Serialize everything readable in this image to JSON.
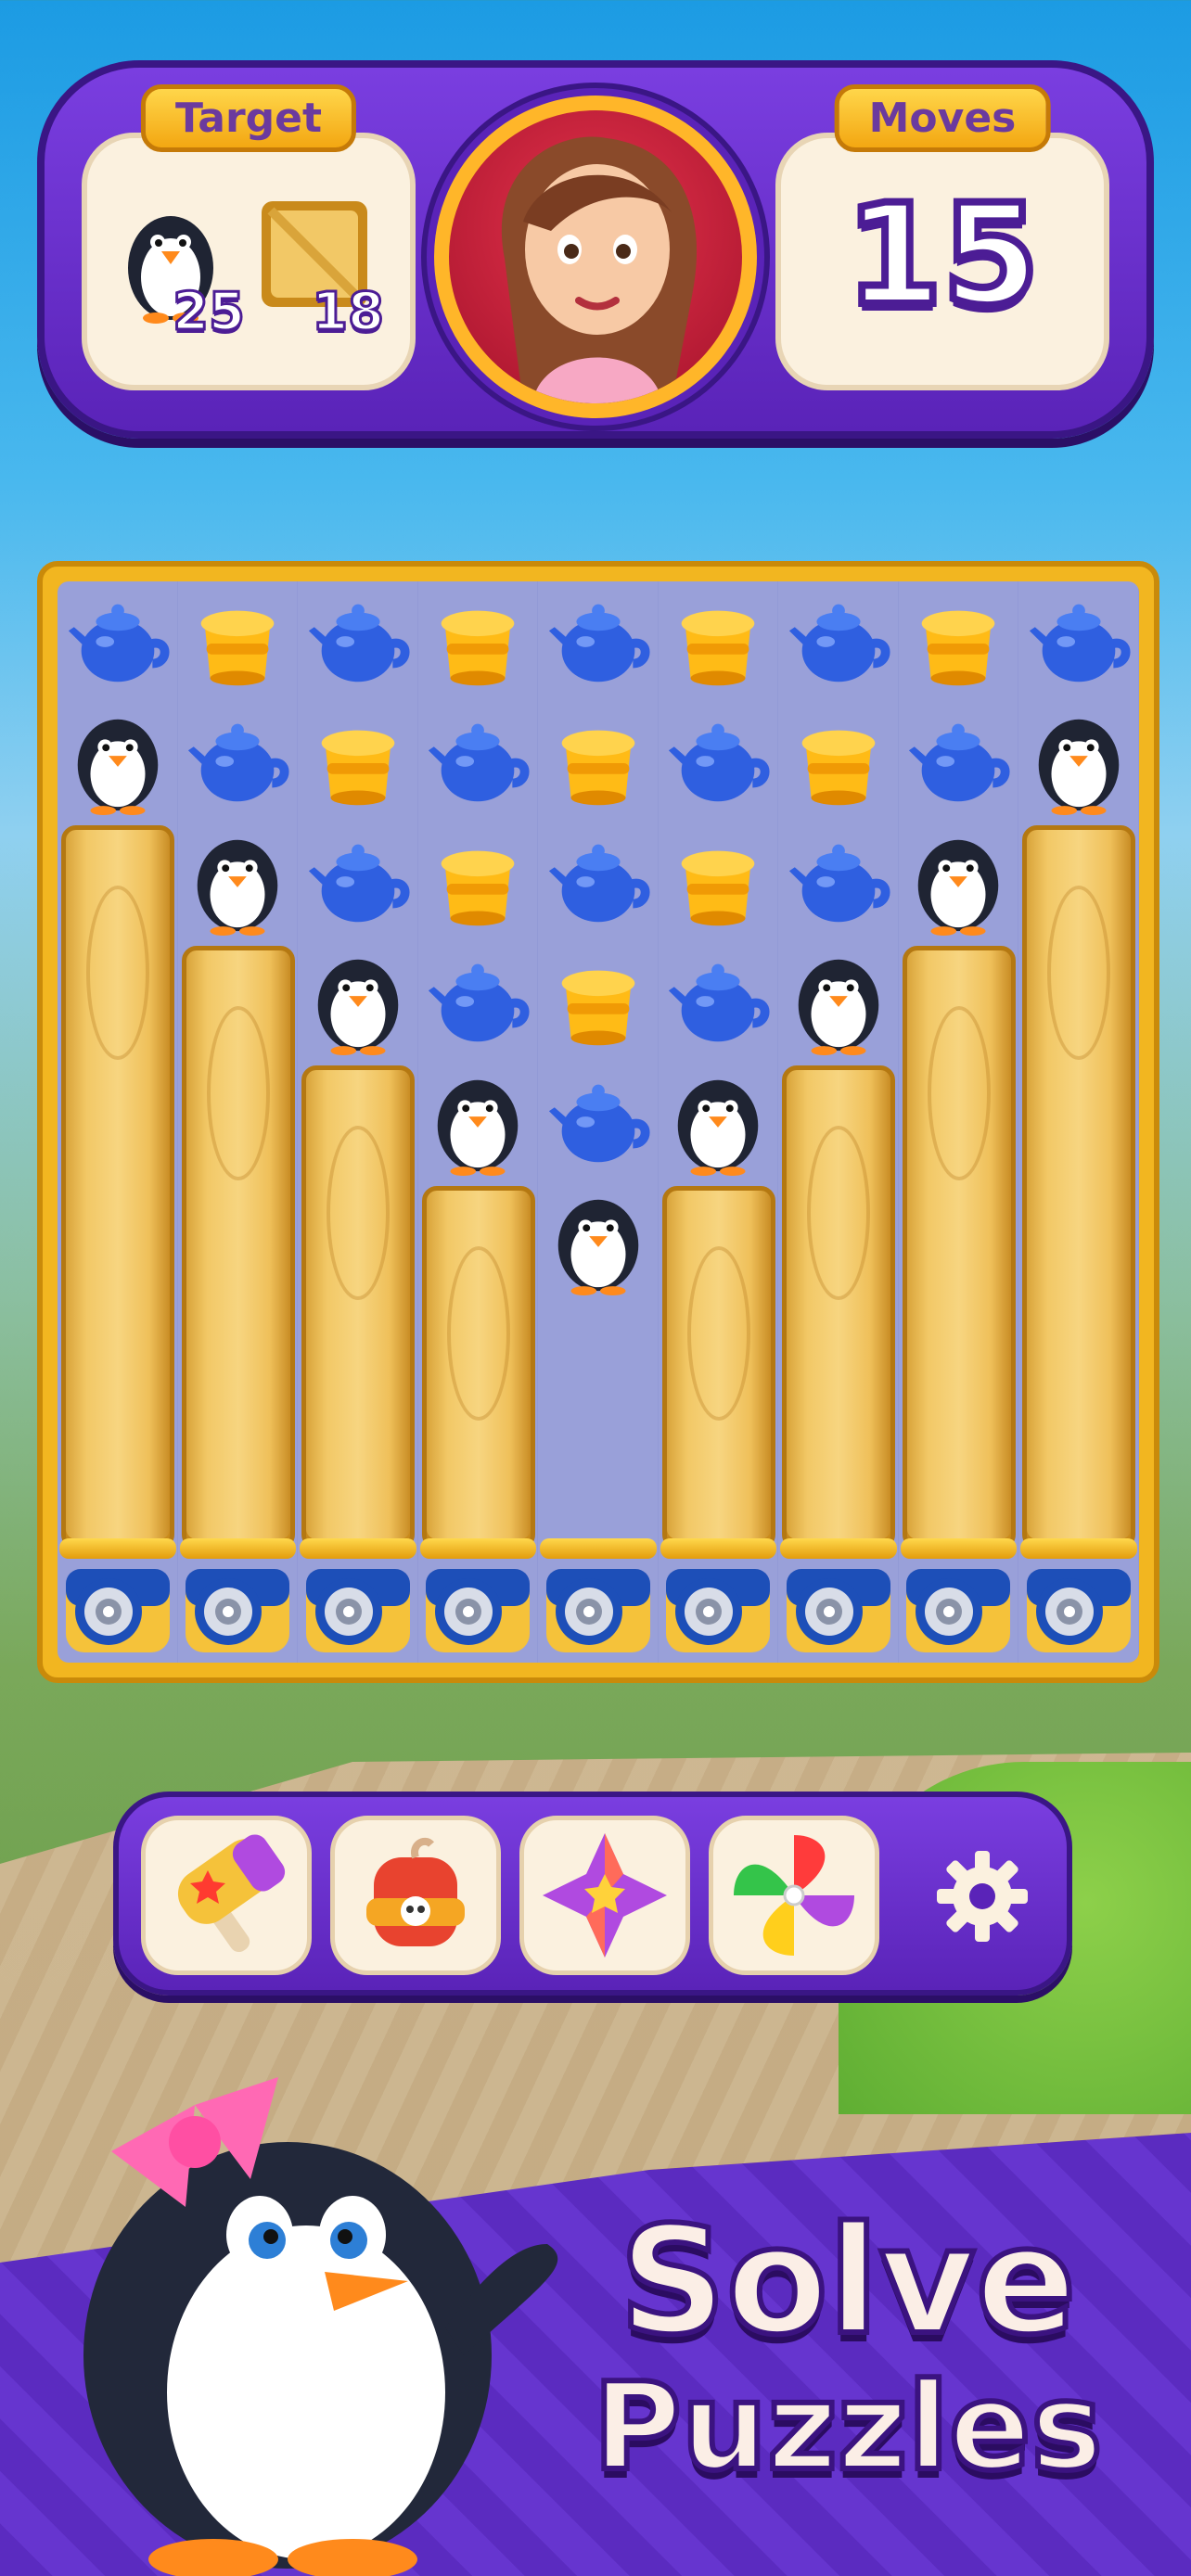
{
  "hud": {
    "target_label": "Target",
    "moves_label": "Moves",
    "moves_value": "15",
    "targets": [
      {
        "icon": "penguin-icon",
        "count": "25"
      },
      {
        "icon": "wood-block-icon",
        "count": "18"
      }
    ],
    "avatar_icon": "character-avatar"
  },
  "board": {
    "rows": [
      [
        "teapot",
        "pot",
        "teapot",
        "pot",
        "teapot",
        "pot",
        "teapot",
        "pot",
        "teapot"
      ],
      [
        "penguin",
        "teapot",
        "pot",
        "teapot",
        "pot",
        "teapot",
        "pot",
        "teapot",
        "penguin"
      ],
      [
        "plank",
        "penguin",
        "teapot",
        "pot",
        "teapot",
        "pot",
        "teapot",
        "penguin",
        "plank"
      ],
      [
        "plank",
        "plank",
        "penguin",
        "teapot",
        "pot",
        "teapot",
        "penguin",
        "plank",
        "plank"
      ],
      [
        "plank",
        "plank",
        "plank",
        "penguin",
        "teapot",
        "penguin",
        "plank",
        "plank",
        "plank"
      ],
      [
        "plank",
        "plank",
        "plank",
        "plank",
        "penguin",
        "plank",
        "plank",
        "plank",
        "plank"
      ]
    ],
    "cannon_icon": "cannon-icon"
  },
  "boosters": [
    {
      "name": "hammer",
      "icon": "hammer-icon"
    },
    {
      "name": "bomb",
      "icon": "bomb-icon"
    },
    {
      "name": "cross-blast",
      "icon": "cross-blast-icon"
    },
    {
      "name": "pinwheel",
      "icon": "pinwheel-icon"
    }
  ],
  "settings_icon": "gear-icon",
  "promo": {
    "line1": "Solve",
    "line2": "Puzzles"
  },
  "colors": {
    "hud_purple": "#5a23b8",
    "label_gold": "#f3a712",
    "board_gold": "#f2b620",
    "grid_lavender": "#8b93d4",
    "teapot_blue": "#2f5fe0",
    "pot_yellow": "#ffbb16"
  }
}
